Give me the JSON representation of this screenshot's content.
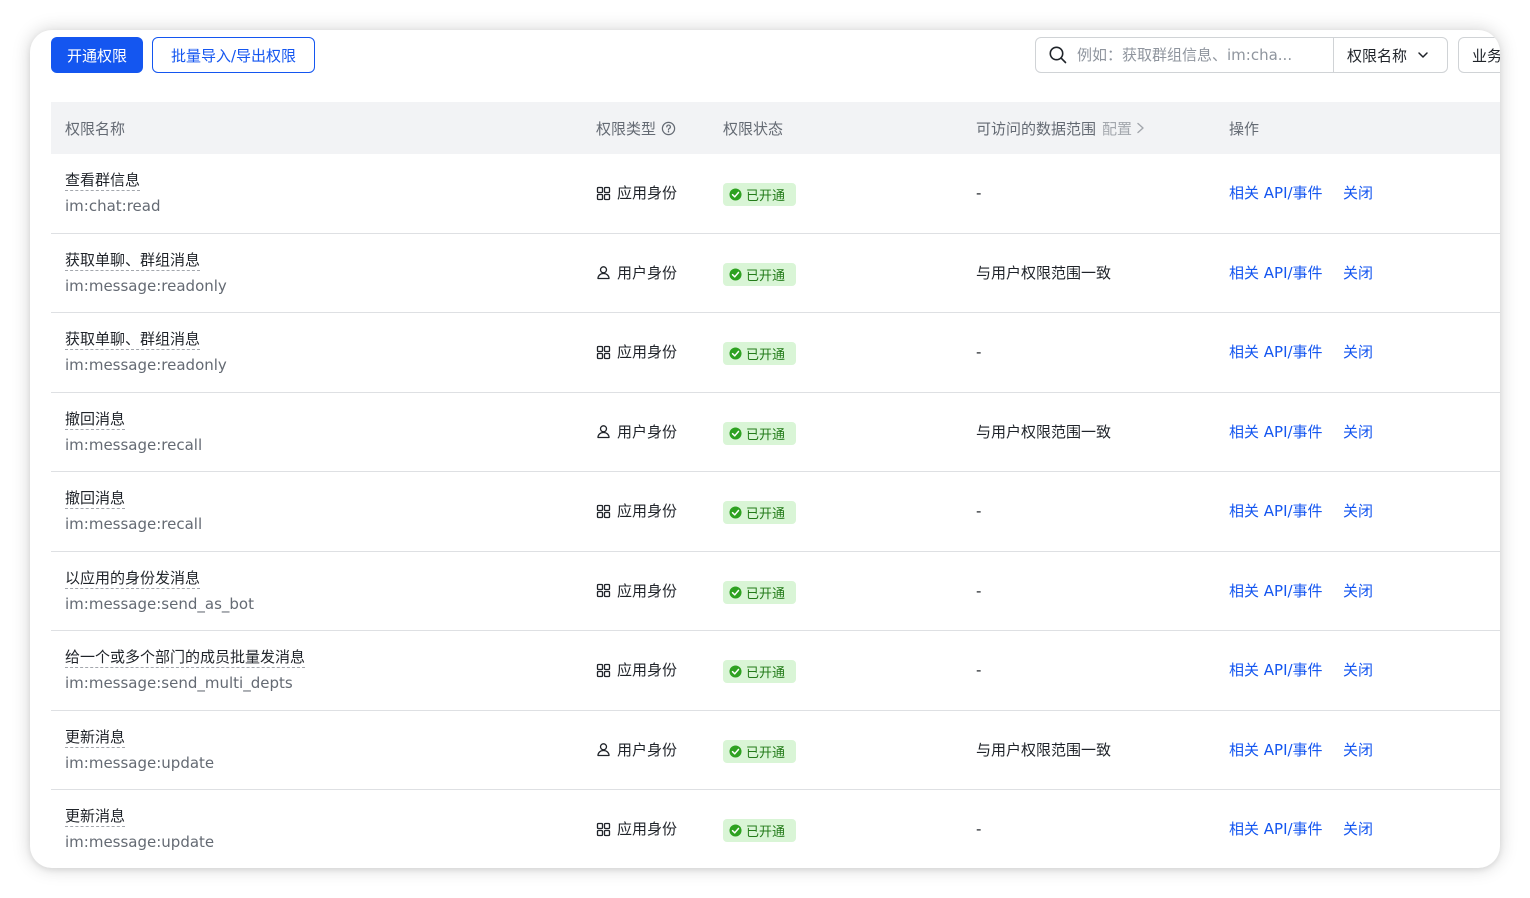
{
  "toolbar": {
    "enable_button": "开通权限",
    "batch_button": "批量导入/导出权限",
    "search_placeholder": "例如：获取群组信息、im:cha...",
    "search_field_select": "权限名称",
    "filter_button_partial": "业务"
  },
  "table": {
    "headers": {
      "name": "权限名称",
      "type": "权限类型",
      "status": "权限状态",
      "scope": "可访问的数据范围",
      "scope_config": "配置",
      "actions": "操作"
    },
    "rows": [
      {
        "name": "查看群信息",
        "code": "im:chat:read",
        "type": "应用身份",
        "type_icon": "grid-icon",
        "status": "已开通",
        "scope": "-",
        "action_api": "相关 API/事件",
        "action_close": "关闭"
      },
      {
        "name": "获取单聊、群组消息",
        "code": "im:message:readonly",
        "type": "用户身份",
        "type_icon": "user-icon",
        "status": "已开通",
        "scope": "与用户权限范围一致",
        "action_api": "相关 API/事件",
        "action_close": "关闭"
      },
      {
        "name": "获取单聊、群组消息",
        "code": "im:message:readonly",
        "type": "应用身份",
        "type_icon": "grid-icon",
        "status": "已开通",
        "scope": "-",
        "action_api": "相关 API/事件",
        "action_close": "关闭"
      },
      {
        "name": "撤回消息",
        "code": "im:message:recall",
        "type": "用户身份",
        "type_icon": "user-icon",
        "status": "已开通",
        "scope": "与用户权限范围一致",
        "action_api": "相关 API/事件",
        "action_close": "关闭"
      },
      {
        "name": "撤回消息",
        "code": "im:message:recall",
        "type": "应用身份",
        "type_icon": "grid-icon",
        "status": "已开通",
        "scope": "-",
        "action_api": "相关 API/事件",
        "action_close": "关闭"
      },
      {
        "name": "以应用的身份发消息",
        "code": "im:message:send_as_bot",
        "type": "应用身份",
        "type_icon": "grid-icon",
        "status": "已开通",
        "scope": "-",
        "action_api": "相关 API/事件",
        "action_close": "关闭"
      },
      {
        "name": "给一个或多个部门的成员批量发消息",
        "code": "im:message:send_multi_depts",
        "type": "应用身份",
        "type_icon": "grid-icon",
        "status": "已开通",
        "scope": "-",
        "action_api": "相关 API/事件",
        "action_close": "关闭"
      },
      {
        "name": "更新消息",
        "code": "im:message:update",
        "type": "用户身份",
        "type_icon": "user-icon",
        "status": "已开通",
        "scope": "与用户权限范围一致",
        "action_api": "相关 API/事件",
        "action_close": "关闭"
      },
      {
        "name": "更新消息",
        "code": "im:message:update",
        "type": "应用身份",
        "type_icon": "grid-icon",
        "status": "已开通",
        "scope": "-",
        "action_api": "相关 API/事件",
        "action_close": "关闭"
      }
    ]
  },
  "colors": {
    "primary": "#1456f0",
    "success_bg": "#d9f5d6",
    "success_text": "#237b19",
    "header_bg": "#f2f3f5"
  }
}
